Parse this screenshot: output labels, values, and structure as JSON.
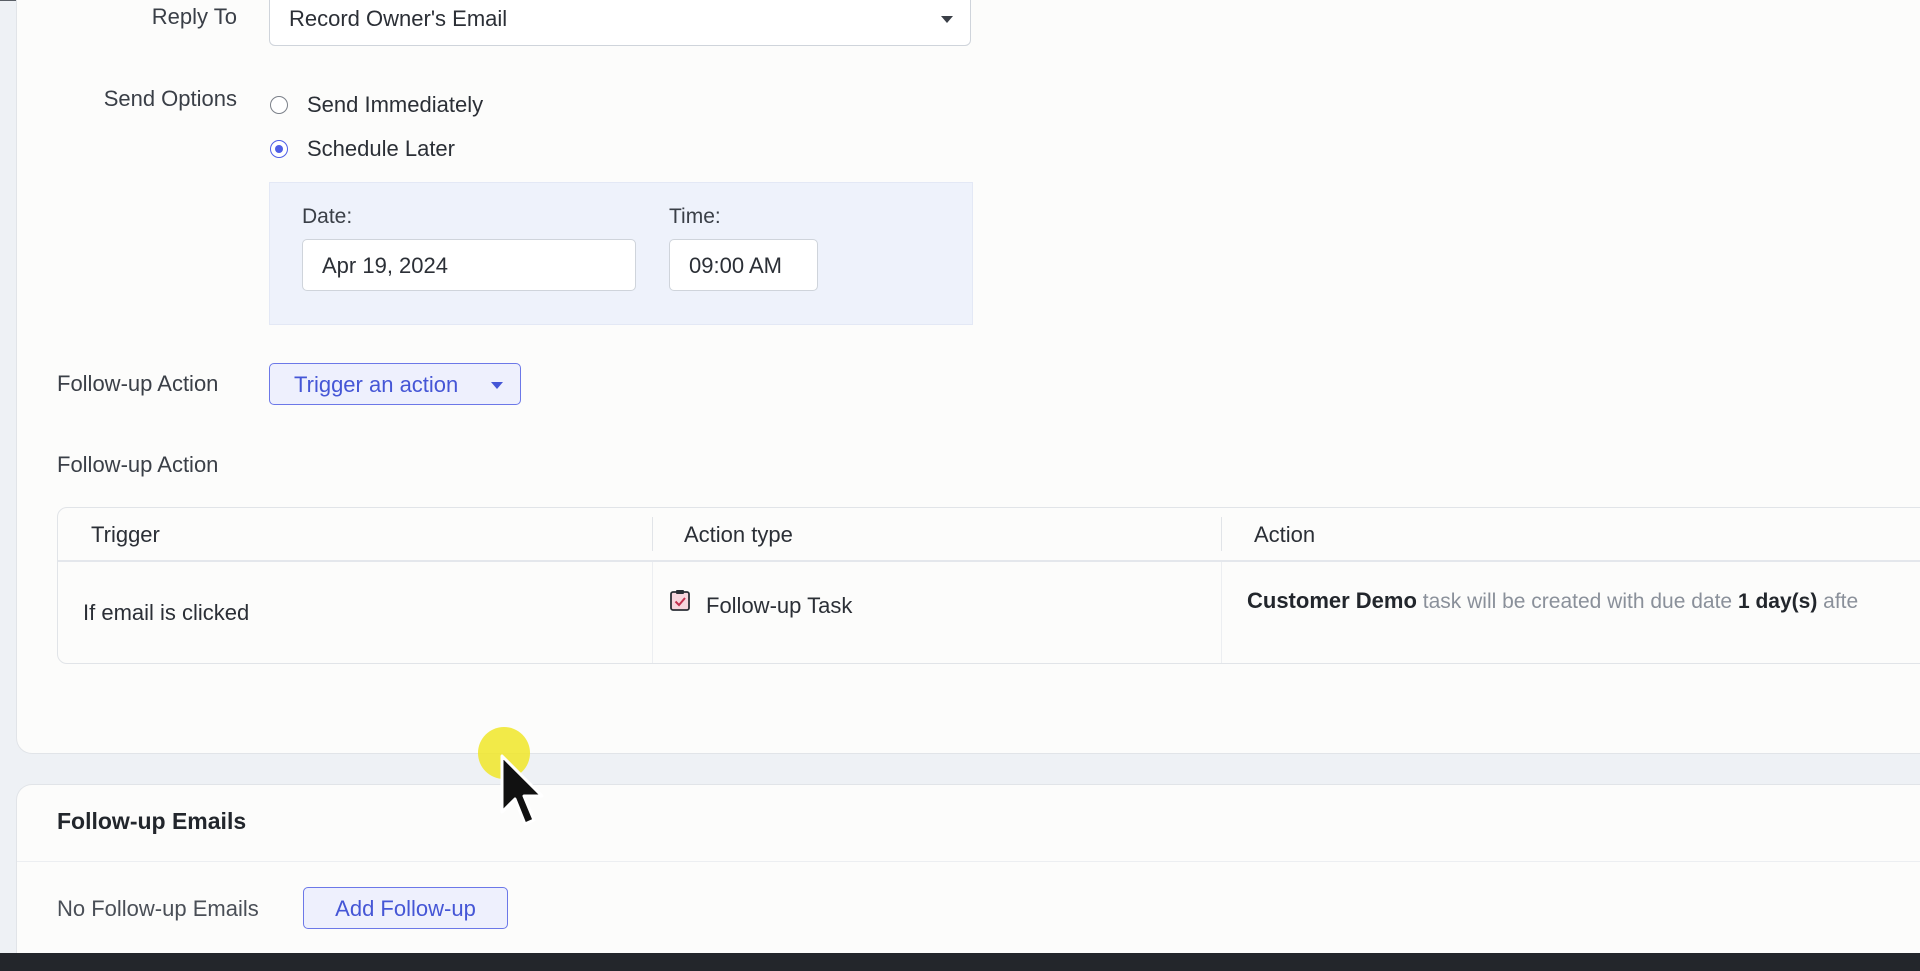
{
  "form": {
    "reply_to": {
      "label": "Reply To",
      "value": "Record Owner's Email"
    },
    "send_options": {
      "label": "Send Options",
      "options": [
        {
          "label": "Send Immediately",
          "selected": false
        },
        {
          "label": "Schedule Later",
          "selected": true
        }
      ]
    },
    "schedule": {
      "date_label": "Date:",
      "date_value": "Apr 19, 2024",
      "time_label": "Time:",
      "time_value": "09:00 AM"
    },
    "followup_action": {
      "label": "Follow-up Action",
      "button_label": "Trigger an action"
    }
  },
  "followup_table": {
    "section_label": "Follow-up Action",
    "columns": [
      "Trigger",
      "Action type",
      "Action"
    ],
    "rows": [
      {
        "trigger": "If email is clicked",
        "action_type": "Follow-up Task",
        "action_name": "Customer Demo",
        "action_mid": "task will be created with due date",
        "action_due": "1 day(s)",
        "action_tail": "afte"
      }
    ]
  },
  "followup_emails": {
    "title": "Follow-up Emails",
    "empty_text": "No Follow-up Emails",
    "add_button": "Add Follow-up"
  },
  "icons": {
    "dropdown": "chevron-down-icon",
    "task": "task-checklist-icon",
    "pointer": "mouse-pointer-icon"
  },
  "colors": {
    "accent": "#4f5ee6",
    "button_text": "#4556d6",
    "schedule_bg": "#eef2fb",
    "highlight": "#f0e628"
  }
}
